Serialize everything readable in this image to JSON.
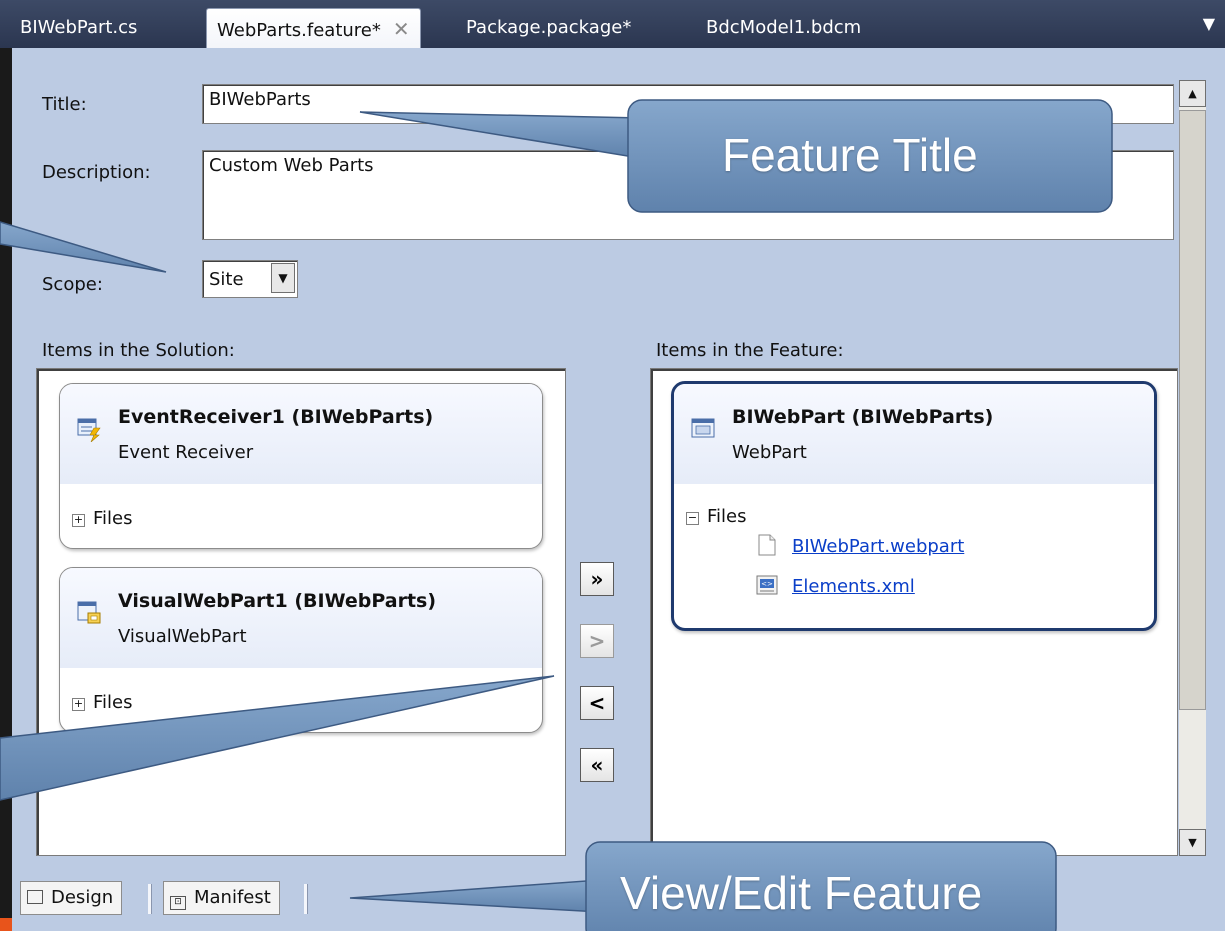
{
  "tabs": [
    {
      "label": "BIWebPart.cs",
      "active": false
    },
    {
      "label": "WebParts.feature*",
      "active": true,
      "close_icon": "close-icon"
    },
    {
      "label": "Package.package*",
      "active": false
    },
    {
      "label": "BdcModel1.bdcm",
      "active": false
    }
  ],
  "form": {
    "title_label": "Title:",
    "title_value": "BIWebParts",
    "description_label": "Description:",
    "description_value": "Custom Web Parts",
    "scope_label": "Scope:",
    "scope_value": "Site"
  },
  "solution": {
    "heading": "Items in the Solution:",
    "items": [
      {
        "title": "EventReceiver1 (BIWebParts)",
        "type": "Event Receiver",
        "files_label": "Files",
        "icon": "event-receiver-icon"
      },
      {
        "title": "VisualWebPart1 (BIWebParts)",
        "type": "VisualWebPart",
        "files_label": "Files",
        "icon": "visual-webpart-icon"
      }
    ]
  },
  "feature": {
    "heading": "Items in the Feature:",
    "items": [
      {
        "title": "BIWebPart (BIWebParts)",
        "type": "WebPart",
        "files_label": "Files",
        "files": [
          "BIWebPart.webpart",
          "Elements.xml"
        ],
        "icon": "webpart-icon"
      }
    ]
  },
  "move_buttons": {
    "add_all": "»",
    "add": ">",
    "remove": "<",
    "remove_all": "«"
  },
  "views": {
    "design": "Design",
    "manifest": "Manifest"
  },
  "callouts": {
    "feature_title": "Feature Title",
    "view_edit": "View/Edit Feature"
  },
  "colors": {
    "callout": "#6d8fb5",
    "designer_background": "#bccbe3",
    "tab_bar": "#34405a",
    "link": "#0a3ec8"
  }
}
